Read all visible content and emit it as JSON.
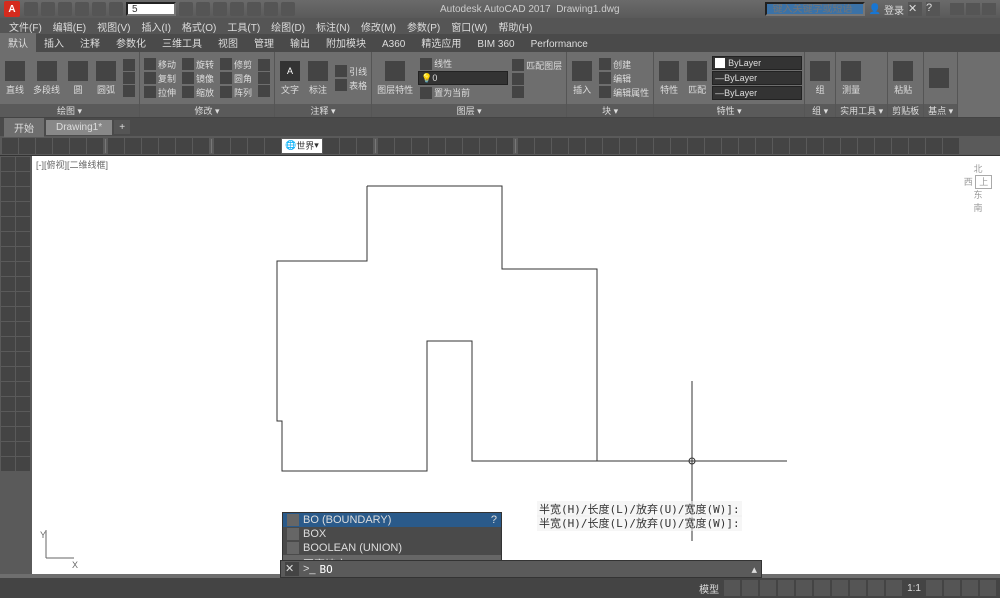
{
  "app": {
    "title_vendor": "Autodesk AutoCAD 2017",
    "title_doc": "Drawing1.dwg",
    "search_qat_value": "5",
    "search_help_placeholder": "键入关键字或短语",
    "user_label": "登录"
  },
  "menu": [
    "文件(F)",
    "编辑(E)",
    "视图(V)",
    "插入(I)",
    "格式(O)",
    "工具(T)",
    "绘图(D)",
    "标注(N)",
    "修改(M)",
    "参数(P)",
    "窗口(W)",
    "帮助(H)"
  ],
  "ribbon_tabs": [
    "默认",
    "插入",
    "注释",
    "参数化",
    "三维工具",
    "视图",
    "管理",
    "输出",
    "附加模块",
    "A360",
    "精选应用",
    "BIM 360",
    "Performance"
  ],
  "ribbon_active_tab": "默认",
  "panels": {
    "draw": {
      "title": "绘图 ▾",
      "items": [
        "直线",
        "多段线",
        "圆",
        "圆弧"
      ]
    },
    "modify": {
      "title": "修改 ▾",
      "items": [
        "移动",
        "复制",
        "拉伸",
        "旋转",
        "镜像",
        "缩放",
        "修剪",
        "圆角",
        "阵列"
      ]
    },
    "annot": {
      "title": "注释 ▾",
      "items": [
        "文字",
        "标注",
        "引线",
        "表格"
      ]
    },
    "layers": {
      "title": "图层 ▾",
      "items": [
        "图层特性",
        "线性",
        "置为当前",
        "匹配图层"
      ],
      "combo": "0"
    },
    "block": {
      "title": "块 ▾",
      "items": [
        "插入",
        "创建",
        "编辑",
        "编辑属性"
      ]
    },
    "props": {
      "title": "特性 ▾",
      "items": [
        "特性",
        "匹配"
      ],
      "layer1": "ByLayer",
      "layer2": "ByLayer",
      "layer3": "ByLayer"
    },
    "group": {
      "title": "组 ▾",
      "items": [
        "组"
      ]
    },
    "util": {
      "title": "实用工具 ▾",
      "items": [
        "测量"
      ]
    },
    "clip": {
      "title": "剪贴板",
      "items": [
        "粘贴"
      ]
    },
    "base": {
      "title": "基点 ▾"
    }
  },
  "doc_tabs": [
    "开始",
    "Drawing1*"
  ],
  "doc_active": "Drawing1*",
  "toolbar2": {
    "world_label": "世界"
  },
  "view_label": "[-][俯视][二维线框]",
  "ucs": {
    "x": "X",
    "y": "Y"
  },
  "navcube": {
    "n": "北",
    "w": "西",
    "e": "东",
    "top": "上",
    "s": "南"
  },
  "autocomplete": {
    "items": [
      {
        "label": "BO (BOUNDARY)",
        "selected": true
      },
      {
        "label": "BOX",
        "selected": false
      },
      {
        "label": "BOOLEAN (UNION)",
        "selected": false
      },
      {
        "label": "图案填充: AR-HBONE",
        "selected": false
      }
    ]
  },
  "prompt_echo": [
    "半宽(H)/长度(L)/放弃(U)/宽度(W)]:",
    "半宽(H)/长度(L)/放弃(U)/宽度(W)]:"
  ],
  "command": {
    "prompt": ">_",
    "value": "BO"
  },
  "status": {
    "model": "模型",
    "scale": "1:1"
  }
}
